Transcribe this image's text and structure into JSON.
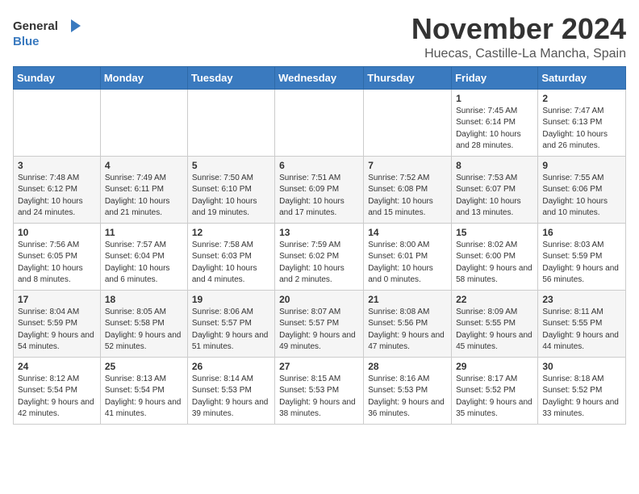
{
  "logo": {
    "general": "General",
    "blue": "Blue"
  },
  "title": "November 2024",
  "location": "Huecas, Castille-La Mancha, Spain",
  "weekdays": [
    "Sunday",
    "Monday",
    "Tuesday",
    "Wednesday",
    "Thursday",
    "Friday",
    "Saturday"
  ],
  "weeks": [
    [
      {
        "day": "",
        "info": ""
      },
      {
        "day": "",
        "info": ""
      },
      {
        "day": "",
        "info": ""
      },
      {
        "day": "",
        "info": ""
      },
      {
        "day": "",
        "info": ""
      },
      {
        "day": "1",
        "info": "Sunrise: 7:45 AM\nSunset: 6:14 PM\nDaylight: 10 hours and 28 minutes."
      },
      {
        "day": "2",
        "info": "Sunrise: 7:47 AM\nSunset: 6:13 PM\nDaylight: 10 hours and 26 minutes."
      }
    ],
    [
      {
        "day": "3",
        "info": "Sunrise: 7:48 AM\nSunset: 6:12 PM\nDaylight: 10 hours and 24 minutes."
      },
      {
        "day": "4",
        "info": "Sunrise: 7:49 AM\nSunset: 6:11 PM\nDaylight: 10 hours and 21 minutes."
      },
      {
        "day": "5",
        "info": "Sunrise: 7:50 AM\nSunset: 6:10 PM\nDaylight: 10 hours and 19 minutes."
      },
      {
        "day": "6",
        "info": "Sunrise: 7:51 AM\nSunset: 6:09 PM\nDaylight: 10 hours and 17 minutes."
      },
      {
        "day": "7",
        "info": "Sunrise: 7:52 AM\nSunset: 6:08 PM\nDaylight: 10 hours and 15 minutes."
      },
      {
        "day": "8",
        "info": "Sunrise: 7:53 AM\nSunset: 6:07 PM\nDaylight: 10 hours and 13 minutes."
      },
      {
        "day": "9",
        "info": "Sunrise: 7:55 AM\nSunset: 6:06 PM\nDaylight: 10 hours and 10 minutes."
      }
    ],
    [
      {
        "day": "10",
        "info": "Sunrise: 7:56 AM\nSunset: 6:05 PM\nDaylight: 10 hours and 8 minutes."
      },
      {
        "day": "11",
        "info": "Sunrise: 7:57 AM\nSunset: 6:04 PM\nDaylight: 10 hours and 6 minutes."
      },
      {
        "day": "12",
        "info": "Sunrise: 7:58 AM\nSunset: 6:03 PM\nDaylight: 10 hours and 4 minutes."
      },
      {
        "day": "13",
        "info": "Sunrise: 7:59 AM\nSunset: 6:02 PM\nDaylight: 10 hours and 2 minutes."
      },
      {
        "day": "14",
        "info": "Sunrise: 8:00 AM\nSunset: 6:01 PM\nDaylight: 10 hours and 0 minutes."
      },
      {
        "day": "15",
        "info": "Sunrise: 8:02 AM\nSunset: 6:00 PM\nDaylight: 9 hours and 58 minutes."
      },
      {
        "day": "16",
        "info": "Sunrise: 8:03 AM\nSunset: 5:59 PM\nDaylight: 9 hours and 56 minutes."
      }
    ],
    [
      {
        "day": "17",
        "info": "Sunrise: 8:04 AM\nSunset: 5:59 PM\nDaylight: 9 hours and 54 minutes."
      },
      {
        "day": "18",
        "info": "Sunrise: 8:05 AM\nSunset: 5:58 PM\nDaylight: 9 hours and 52 minutes."
      },
      {
        "day": "19",
        "info": "Sunrise: 8:06 AM\nSunset: 5:57 PM\nDaylight: 9 hours and 51 minutes."
      },
      {
        "day": "20",
        "info": "Sunrise: 8:07 AM\nSunset: 5:57 PM\nDaylight: 9 hours and 49 minutes."
      },
      {
        "day": "21",
        "info": "Sunrise: 8:08 AM\nSunset: 5:56 PM\nDaylight: 9 hours and 47 minutes."
      },
      {
        "day": "22",
        "info": "Sunrise: 8:09 AM\nSunset: 5:55 PM\nDaylight: 9 hours and 45 minutes."
      },
      {
        "day": "23",
        "info": "Sunrise: 8:11 AM\nSunset: 5:55 PM\nDaylight: 9 hours and 44 minutes."
      }
    ],
    [
      {
        "day": "24",
        "info": "Sunrise: 8:12 AM\nSunset: 5:54 PM\nDaylight: 9 hours and 42 minutes."
      },
      {
        "day": "25",
        "info": "Sunrise: 8:13 AM\nSunset: 5:54 PM\nDaylight: 9 hours and 41 minutes."
      },
      {
        "day": "26",
        "info": "Sunrise: 8:14 AM\nSunset: 5:53 PM\nDaylight: 9 hours and 39 minutes."
      },
      {
        "day": "27",
        "info": "Sunrise: 8:15 AM\nSunset: 5:53 PM\nDaylight: 9 hours and 38 minutes."
      },
      {
        "day": "28",
        "info": "Sunrise: 8:16 AM\nSunset: 5:53 PM\nDaylight: 9 hours and 36 minutes."
      },
      {
        "day": "29",
        "info": "Sunrise: 8:17 AM\nSunset: 5:52 PM\nDaylight: 9 hours and 35 minutes."
      },
      {
        "day": "30",
        "info": "Sunrise: 8:18 AM\nSunset: 5:52 PM\nDaylight: 9 hours and 33 minutes."
      }
    ]
  ]
}
